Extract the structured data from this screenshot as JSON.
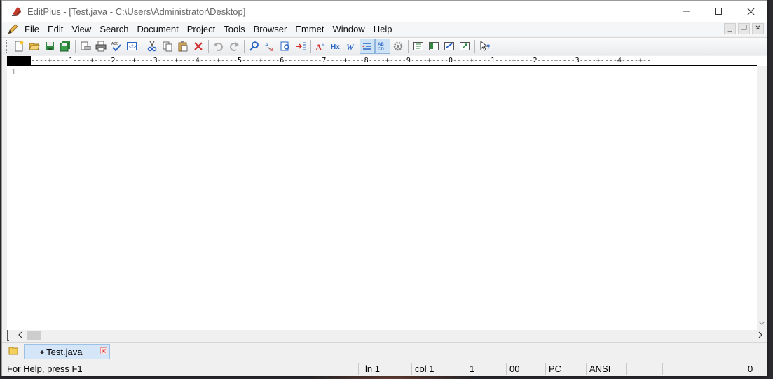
{
  "window": {
    "title": "EditPlus - [Test.java - C:\\Users\\Administrator\\Desktop]"
  },
  "menu": {
    "items": [
      "File",
      "Edit",
      "View",
      "Search",
      "Document",
      "Project",
      "Tools",
      "Browser",
      "Emmet",
      "Window",
      "Help"
    ]
  },
  "ruler": {
    "text": "----+----1----+----2----+----3----+----4----+----5----+----6----+----7----+----8----+----9----+----0----+----1----+----2----+----3----+----4----+--"
  },
  "editor": {
    "line_numbers": [
      "1"
    ]
  },
  "tabs": [
    {
      "label": "Test.java"
    }
  ],
  "status": {
    "help": "For Help, press F1",
    "line": "ln 1",
    "col": "col 1",
    "field3": "1",
    "field4": "00",
    "mode": "PC",
    "encoding": "ANSI",
    "field_end": "0"
  },
  "colors": {
    "tab_active_bg": "#d4e6f8",
    "toolbar_active_bg": "#cfe3f7"
  }
}
